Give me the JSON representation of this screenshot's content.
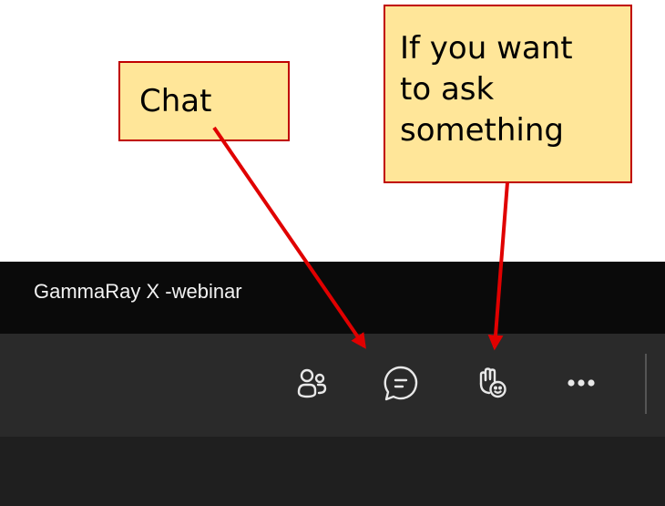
{
  "callouts": {
    "chat": {
      "label": "Chat"
    },
    "ask": {
      "lines": [
        "If you want",
        "to ask",
        "something"
      ]
    }
  },
  "window": {
    "title": "GammaRay X -webinar"
  },
  "toolbar": {
    "buttons": [
      {
        "icon": "people-icon"
      },
      {
        "icon": "chat-icon"
      },
      {
        "icon": "raise-hand-reactions-icon"
      },
      {
        "icon": "more-options-icon"
      }
    ]
  },
  "colors": {
    "callout_fill": "#ffe699",
    "callout_border": "#c00000",
    "arrow": "#e00000",
    "titlebar_bg": "#0a0a0a",
    "toolbar_bg": "#2a2a2a",
    "icon": "#e8e8e8"
  }
}
